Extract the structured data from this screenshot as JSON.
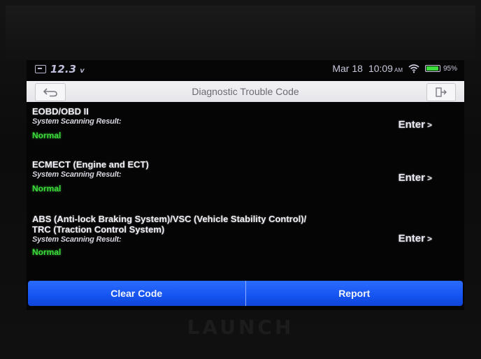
{
  "status_bar": {
    "voltage": "12.3",
    "voltage_unit": "v",
    "date": "Mar 18",
    "time": "10:09",
    "ampm": "AM",
    "battery_percent": "95%",
    "battery_level": 0.95,
    "battery_color": "#3ddc3d"
  },
  "title_bar": {
    "title": "Diagnostic Trouble Code",
    "back_icon": "back-arrow-icon",
    "exit_icon": "exit-icon"
  },
  "systems": [
    {
      "name": "EOBD/OBD II",
      "name_line2": "",
      "subtitle": "System Scanning Result:",
      "status": "Normal",
      "enter_label": "Enter"
    },
    {
      "name": "ECMECT (Engine and ECT)",
      "name_line2": "",
      "subtitle": "System Scanning Result:",
      "status": "Normal",
      "enter_label": "Enter"
    },
    {
      "name": "ABS (Anti-lock Braking System)/VSC (Vehicle Stability Control)/",
      "name_line2": "TRC (Traction Control System)",
      "subtitle": "System Scanning Result:",
      "status": "Normal",
      "enter_label": "Enter"
    }
  ],
  "bottom_bar": {
    "clear_label": "Clear Code",
    "report_label": "Report"
  },
  "brand": "LAUNCH",
  "colors": {
    "accent": "#1554f0",
    "status_normal": "#3cdc3c"
  }
}
